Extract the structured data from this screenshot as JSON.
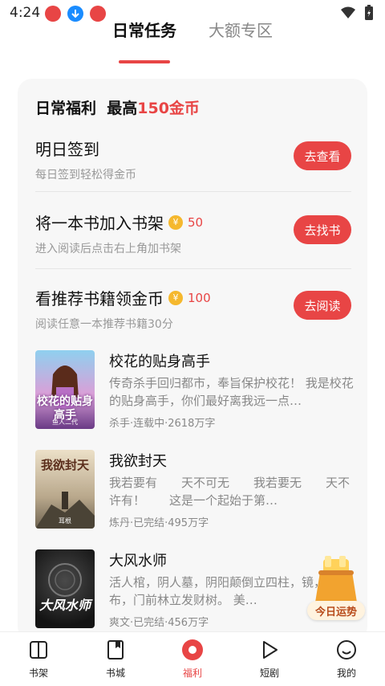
{
  "status": {
    "time": "4:24"
  },
  "tabs": {
    "active": "日常任务",
    "other": "大额专区"
  },
  "card": {
    "title_prefix": "日常福利",
    "title_mid": "最高",
    "title_highlight": "150金币"
  },
  "tasks": [
    {
      "title": "明日签到",
      "reward": "",
      "subtitle": "每日签到轻松得金币",
      "button": "去查看"
    },
    {
      "title": "将一本书加入书架",
      "reward": "50",
      "subtitle": "进入阅读后点击右上角加书架",
      "button": "去找书"
    },
    {
      "title": "看推荐书籍领金币",
      "reward": "100",
      "subtitle": "阅读任意一本推荐书籍30分",
      "button": "去阅读"
    }
  ],
  "coin_symbol": "¥",
  "books": [
    {
      "title": "校花的贴身高手",
      "desc": "传奇杀手回归都市，奉旨保护校花！ 我是校花的贴身高手，你们最好离我远一点…",
      "meta": "杀手·连载中·2618万字",
      "cover_text": "校花的贴身高手",
      "cover_author": "鱼人二代"
    },
    {
      "title": "我欲封天",
      "desc": "我若要有　　天不可无　　我若要无　　天不许有！　　这是一个起始于第…",
      "meta": "炼丹·已完结·495万字",
      "cover_text": "我欲封天",
      "cover_author": "耳根"
    },
    {
      "title": "大风水师",
      "desc": "活人棺，阴人墓，阴阳颠倒立四柱，镜，吸阴布，门前林立发财树。 美…",
      "meta": "爽文·已完结·456万字",
      "cover_text": "大风水师",
      "cover_author": ""
    }
  ],
  "luck_badge": "今日运势",
  "nav": [
    {
      "label": "书架",
      "icon": "bookshelf-icon"
    },
    {
      "label": "书城",
      "icon": "bookstore-icon"
    },
    {
      "label": "福利",
      "icon": "welfare-icon"
    },
    {
      "label": "短剧",
      "icon": "play-icon"
    },
    {
      "label": "我的",
      "icon": "smile-icon"
    }
  ],
  "colors": {
    "accent": "#e84545",
    "coin": "#f5b82e"
  }
}
